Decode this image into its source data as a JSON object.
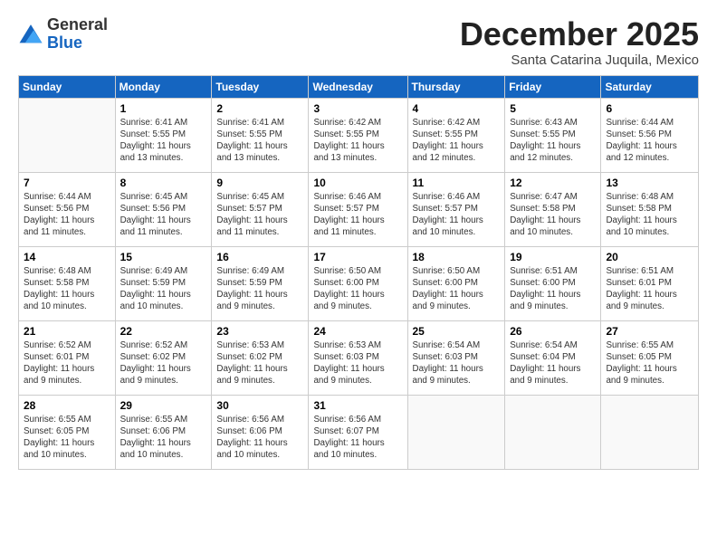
{
  "header": {
    "logo_general": "General",
    "logo_blue": "Blue",
    "month_title": "December 2025",
    "location": "Santa Catarina Juquila, Mexico"
  },
  "weekdays": [
    "Sunday",
    "Monday",
    "Tuesday",
    "Wednesday",
    "Thursday",
    "Friday",
    "Saturday"
  ],
  "weeks": [
    [
      {
        "day": "",
        "detail": ""
      },
      {
        "day": "1",
        "detail": "Sunrise: 6:41 AM\nSunset: 5:55 PM\nDaylight: 11 hours\nand 13 minutes."
      },
      {
        "day": "2",
        "detail": "Sunrise: 6:41 AM\nSunset: 5:55 PM\nDaylight: 11 hours\nand 13 minutes."
      },
      {
        "day": "3",
        "detail": "Sunrise: 6:42 AM\nSunset: 5:55 PM\nDaylight: 11 hours\nand 13 minutes."
      },
      {
        "day": "4",
        "detail": "Sunrise: 6:42 AM\nSunset: 5:55 PM\nDaylight: 11 hours\nand 12 minutes."
      },
      {
        "day": "5",
        "detail": "Sunrise: 6:43 AM\nSunset: 5:55 PM\nDaylight: 11 hours\nand 12 minutes."
      },
      {
        "day": "6",
        "detail": "Sunrise: 6:44 AM\nSunset: 5:56 PM\nDaylight: 11 hours\nand 12 minutes."
      }
    ],
    [
      {
        "day": "7",
        "detail": "Sunrise: 6:44 AM\nSunset: 5:56 PM\nDaylight: 11 hours\nand 11 minutes."
      },
      {
        "day": "8",
        "detail": "Sunrise: 6:45 AM\nSunset: 5:56 PM\nDaylight: 11 hours\nand 11 minutes."
      },
      {
        "day": "9",
        "detail": "Sunrise: 6:45 AM\nSunset: 5:57 PM\nDaylight: 11 hours\nand 11 minutes."
      },
      {
        "day": "10",
        "detail": "Sunrise: 6:46 AM\nSunset: 5:57 PM\nDaylight: 11 hours\nand 11 minutes."
      },
      {
        "day": "11",
        "detail": "Sunrise: 6:46 AM\nSunset: 5:57 PM\nDaylight: 11 hours\nand 10 minutes."
      },
      {
        "day": "12",
        "detail": "Sunrise: 6:47 AM\nSunset: 5:58 PM\nDaylight: 11 hours\nand 10 minutes."
      },
      {
        "day": "13",
        "detail": "Sunrise: 6:48 AM\nSunset: 5:58 PM\nDaylight: 11 hours\nand 10 minutes."
      }
    ],
    [
      {
        "day": "14",
        "detail": "Sunrise: 6:48 AM\nSunset: 5:58 PM\nDaylight: 11 hours\nand 10 minutes."
      },
      {
        "day": "15",
        "detail": "Sunrise: 6:49 AM\nSunset: 5:59 PM\nDaylight: 11 hours\nand 10 minutes."
      },
      {
        "day": "16",
        "detail": "Sunrise: 6:49 AM\nSunset: 5:59 PM\nDaylight: 11 hours\nand 9 minutes."
      },
      {
        "day": "17",
        "detail": "Sunrise: 6:50 AM\nSunset: 6:00 PM\nDaylight: 11 hours\nand 9 minutes."
      },
      {
        "day": "18",
        "detail": "Sunrise: 6:50 AM\nSunset: 6:00 PM\nDaylight: 11 hours\nand 9 minutes."
      },
      {
        "day": "19",
        "detail": "Sunrise: 6:51 AM\nSunset: 6:00 PM\nDaylight: 11 hours\nand 9 minutes."
      },
      {
        "day": "20",
        "detail": "Sunrise: 6:51 AM\nSunset: 6:01 PM\nDaylight: 11 hours\nand 9 minutes."
      }
    ],
    [
      {
        "day": "21",
        "detail": "Sunrise: 6:52 AM\nSunset: 6:01 PM\nDaylight: 11 hours\nand 9 minutes."
      },
      {
        "day": "22",
        "detail": "Sunrise: 6:52 AM\nSunset: 6:02 PM\nDaylight: 11 hours\nand 9 minutes."
      },
      {
        "day": "23",
        "detail": "Sunrise: 6:53 AM\nSunset: 6:02 PM\nDaylight: 11 hours\nand 9 minutes."
      },
      {
        "day": "24",
        "detail": "Sunrise: 6:53 AM\nSunset: 6:03 PM\nDaylight: 11 hours\nand 9 minutes."
      },
      {
        "day": "25",
        "detail": "Sunrise: 6:54 AM\nSunset: 6:03 PM\nDaylight: 11 hours\nand 9 minutes."
      },
      {
        "day": "26",
        "detail": "Sunrise: 6:54 AM\nSunset: 6:04 PM\nDaylight: 11 hours\nand 9 minutes."
      },
      {
        "day": "27",
        "detail": "Sunrise: 6:55 AM\nSunset: 6:05 PM\nDaylight: 11 hours\nand 9 minutes."
      }
    ],
    [
      {
        "day": "28",
        "detail": "Sunrise: 6:55 AM\nSunset: 6:05 PM\nDaylight: 11 hours\nand 10 minutes."
      },
      {
        "day": "29",
        "detail": "Sunrise: 6:55 AM\nSunset: 6:06 PM\nDaylight: 11 hours\nand 10 minutes."
      },
      {
        "day": "30",
        "detail": "Sunrise: 6:56 AM\nSunset: 6:06 PM\nDaylight: 11 hours\nand 10 minutes."
      },
      {
        "day": "31",
        "detail": "Sunrise: 6:56 AM\nSunset: 6:07 PM\nDaylight: 11 hours\nand 10 minutes."
      },
      {
        "day": "",
        "detail": ""
      },
      {
        "day": "",
        "detail": ""
      },
      {
        "day": "",
        "detail": ""
      }
    ]
  ]
}
